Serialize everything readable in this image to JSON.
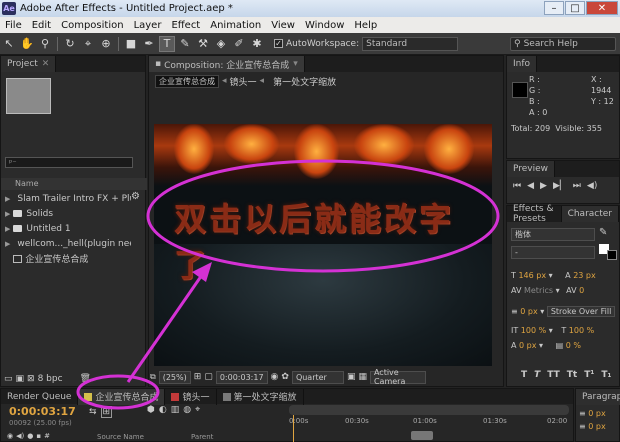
{
  "window": {
    "title": "Adobe After Effects - Untitled Project.aep *",
    "app_icon": "Ae"
  },
  "menu": [
    "File",
    "Edit",
    "Composition",
    "Layer",
    "Effect",
    "Animation",
    "View",
    "Window",
    "Help"
  ],
  "toolbar": {
    "auto_workspace": "AutoWorkspace:",
    "workspace": "Standard",
    "search_placeholder": "Search Help"
  },
  "project": {
    "tab": "Project",
    "search_text": "ᵖ⁻",
    "name_header": "Name",
    "items": [
      "Slam Trailer Intro FX + Plug-ins",
      "Solids",
      "Untitled 1",
      "wellcom..._hell(plugin needed)",
      "企业宣传总合成"
    ],
    "bpc": "8 bpc"
  },
  "composition": {
    "tab": "Composition: 企业宣传总合成",
    "breadcrumbs": [
      "企业宣传总合成",
      "镜头一",
      "第一处文字缩放"
    ],
    "overlay_text": "双击以后就能改字了",
    "zoom": "(25%)",
    "time": "0:00:03:17",
    "resolution": "Quarter",
    "camera": "Active Camera"
  },
  "info": {
    "tab": "Info",
    "r": "R :",
    "g": "G :",
    "b": "B :",
    "a": "A : 0",
    "x": "X : 1944",
    "y": "Y : 12",
    "total": "Total: 209",
    "visible": "Visible: 355"
  },
  "preview": {
    "tab": "Preview"
  },
  "effects_tab": "Effects & Presets",
  "character": {
    "tab": "Character",
    "font": "楷体",
    "size": "146 px",
    "leading": "23 px",
    "kerning": "Metrics",
    "tracking": "0",
    "stroke_width": "0 px",
    "stroke_mode": "Stroke Over Fill",
    "vscale": "100 %",
    "hscale": "100 %",
    "baseline": "0 px",
    "tsume": "0 %",
    "style_buttons": [
      "T",
      "T",
      "TT",
      "Tt",
      "T¹",
      "T₁"
    ]
  },
  "timeline": {
    "render_queue": "Render Queue",
    "tabs": [
      "企业宣传总合成",
      "镜头一",
      "第一处文字缩放"
    ],
    "timecode": "0:00:03:17",
    "fps": "00092 (25.00 fps)",
    "ruler": [
      "0:00s",
      "00:30s",
      "01:00s",
      "01:30s",
      "02:00"
    ],
    "col_source": "Source Name",
    "col_parent": "Parent",
    "paragraph_tab": "Paragraph",
    "para_values": [
      "0 px",
      "0 px"
    ]
  },
  "colors": {
    "accent_blue": "#6aa9ff",
    "timecode_orange": "#e0a541",
    "annotation_magenta": "#d431d4"
  }
}
